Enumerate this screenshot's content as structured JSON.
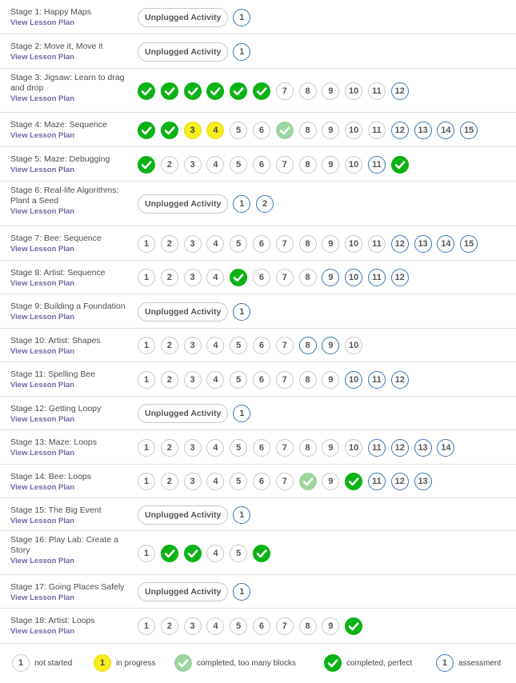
{
  "link_label": "View Lesson Plan",
  "stages": [
    {
      "title": "Stage 1: Happy Maps",
      "unplugged": "Unplugged Activity",
      "bubbles": [
        {
          "label": "1",
          "state": "assessment"
        }
      ]
    },
    {
      "title": "Stage 2: Move it, Move it",
      "unplugged": "Unplugged Activity",
      "bubbles": [
        {
          "label": "1",
          "state": "assessment"
        }
      ]
    },
    {
      "title": "Stage 3: Jigsaw: Learn to drag and drop",
      "bubbles": [
        {
          "label": "1",
          "state": "perfect"
        },
        {
          "label": "2",
          "state": "perfect"
        },
        {
          "label": "3",
          "state": "perfect"
        },
        {
          "label": "4",
          "state": "perfect"
        },
        {
          "label": "5",
          "state": "perfect"
        },
        {
          "label": "6",
          "state": "perfect"
        },
        {
          "label": "7",
          "state": "not-started"
        },
        {
          "label": "8",
          "state": "not-started"
        },
        {
          "label": "9",
          "state": "not-started"
        },
        {
          "label": "10",
          "state": "not-started"
        },
        {
          "label": "11",
          "state": "not-started"
        },
        {
          "label": "12",
          "state": "assessment"
        }
      ]
    },
    {
      "title": "Stage 4: Maze: Sequence",
      "bubbles": [
        {
          "label": "1",
          "state": "perfect"
        },
        {
          "label": "2",
          "state": "perfect"
        },
        {
          "label": "3",
          "state": "in-progress"
        },
        {
          "label": "4",
          "state": "in-progress"
        },
        {
          "label": "5",
          "state": "not-started"
        },
        {
          "label": "6",
          "state": "not-started"
        },
        {
          "label": "7",
          "state": "too-many-blocks"
        },
        {
          "label": "8",
          "state": "not-started"
        },
        {
          "label": "9",
          "state": "not-started"
        },
        {
          "label": "10",
          "state": "not-started"
        },
        {
          "label": "11",
          "state": "not-started"
        },
        {
          "label": "12",
          "state": "assessment"
        },
        {
          "label": "13",
          "state": "assessment"
        },
        {
          "label": "14",
          "state": "assessment"
        },
        {
          "label": "15",
          "state": "assessment"
        }
      ]
    },
    {
      "title": "Stage 5: Maze: Debugging",
      "bubbles": [
        {
          "label": "1",
          "state": "perfect"
        },
        {
          "label": "2",
          "state": "not-started"
        },
        {
          "label": "3",
          "state": "not-started"
        },
        {
          "label": "4",
          "state": "not-started"
        },
        {
          "label": "5",
          "state": "not-started"
        },
        {
          "label": "6",
          "state": "not-started"
        },
        {
          "label": "7",
          "state": "not-started"
        },
        {
          "label": "8",
          "state": "not-started"
        },
        {
          "label": "9",
          "state": "not-started"
        },
        {
          "label": "10",
          "state": "not-started"
        },
        {
          "label": "11",
          "state": "assessment"
        },
        {
          "label": "12",
          "state": "perfect"
        }
      ]
    },
    {
      "title": "Stage 6: Real-life Algorithms: Plant a Seed",
      "unplugged": "Unplugged Activity",
      "bubbles": [
        {
          "label": "1",
          "state": "assessment"
        },
        {
          "label": "2",
          "state": "assessment"
        }
      ]
    },
    {
      "title": "Stage 7: Bee: Sequence",
      "bubbles": [
        {
          "label": "1",
          "state": "not-started"
        },
        {
          "label": "2",
          "state": "not-started"
        },
        {
          "label": "3",
          "state": "not-started"
        },
        {
          "label": "4",
          "state": "not-started"
        },
        {
          "label": "5",
          "state": "not-started"
        },
        {
          "label": "6",
          "state": "not-started"
        },
        {
          "label": "7",
          "state": "not-started"
        },
        {
          "label": "8",
          "state": "not-started"
        },
        {
          "label": "9",
          "state": "not-started"
        },
        {
          "label": "10",
          "state": "not-started"
        },
        {
          "label": "11",
          "state": "not-started"
        },
        {
          "label": "12",
          "state": "assessment"
        },
        {
          "label": "13",
          "state": "assessment"
        },
        {
          "label": "14",
          "state": "assessment"
        },
        {
          "label": "15",
          "state": "assessment"
        }
      ]
    },
    {
      "title": "Stage 8: Artist: Sequence",
      "bubbles": [
        {
          "label": "1",
          "state": "not-started"
        },
        {
          "label": "2",
          "state": "not-started"
        },
        {
          "label": "3",
          "state": "not-started"
        },
        {
          "label": "4",
          "state": "not-started"
        },
        {
          "label": "5",
          "state": "perfect"
        },
        {
          "label": "6",
          "state": "not-started"
        },
        {
          "label": "7",
          "state": "not-started"
        },
        {
          "label": "8",
          "state": "not-started"
        },
        {
          "label": "9",
          "state": "assessment"
        },
        {
          "label": "10",
          "state": "assessment"
        },
        {
          "label": "11",
          "state": "assessment"
        },
        {
          "label": "12",
          "state": "assessment"
        }
      ]
    },
    {
      "title": "Stage 9: Building a Foundation",
      "unplugged": "Unplugged Activity",
      "bubbles": [
        {
          "label": "1",
          "state": "assessment"
        }
      ]
    },
    {
      "title": "Stage 10: Artist: Shapes",
      "bubbles": [
        {
          "label": "1",
          "state": "not-started"
        },
        {
          "label": "2",
          "state": "not-started"
        },
        {
          "label": "3",
          "state": "not-started"
        },
        {
          "label": "4",
          "state": "not-started"
        },
        {
          "label": "5",
          "state": "not-started"
        },
        {
          "label": "6",
          "state": "not-started"
        },
        {
          "label": "7",
          "state": "not-started"
        },
        {
          "label": "8",
          "state": "assessment"
        },
        {
          "label": "9",
          "state": "assessment"
        },
        {
          "label": "10",
          "state": "not-started"
        }
      ]
    },
    {
      "title": "Stage 11: Spelling Bee",
      "bubbles": [
        {
          "label": "1",
          "state": "not-started"
        },
        {
          "label": "2",
          "state": "not-started"
        },
        {
          "label": "3",
          "state": "not-started"
        },
        {
          "label": "4",
          "state": "not-started"
        },
        {
          "label": "5",
          "state": "not-started"
        },
        {
          "label": "6",
          "state": "not-started"
        },
        {
          "label": "7",
          "state": "not-started"
        },
        {
          "label": "8",
          "state": "not-started"
        },
        {
          "label": "9",
          "state": "not-started"
        },
        {
          "label": "10",
          "state": "assessment"
        },
        {
          "label": "11",
          "state": "assessment"
        },
        {
          "label": "12",
          "state": "assessment"
        }
      ]
    },
    {
      "title": "Stage 12: Getting Loopy",
      "unplugged": "Unplugged Activity",
      "bubbles": [
        {
          "label": "1",
          "state": "assessment"
        }
      ]
    },
    {
      "title": "Stage 13: Maze: Loops",
      "bubbles": [
        {
          "label": "1",
          "state": "not-started"
        },
        {
          "label": "2",
          "state": "not-started"
        },
        {
          "label": "3",
          "state": "not-started"
        },
        {
          "label": "4",
          "state": "not-started"
        },
        {
          "label": "5",
          "state": "not-started"
        },
        {
          "label": "6",
          "state": "not-started"
        },
        {
          "label": "7",
          "state": "not-started"
        },
        {
          "label": "8",
          "state": "not-started"
        },
        {
          "label": "9",
          "state": "not-started"
        },
        {
          "label": "10",
          "state": "not-started"
        },
        {
          "label": "11",
          "state": "assessment"
        },
        {
          "label": "12",
          "state": "assessment"
        },
        {
          "label": "13",
          "state": "assessment"
        },
        {
          "label": "14",
          "state": "assessment"
        }
      ]
    },
    {
      "title": "Stage 14: Bee: Loops",
      "bubbles": [
        {
          "label": "1",
          "state": "not-started"
        },
        {
          "label": "2",
          "state": "not-started"
        },
        {
          "label": "3",
          "state": "not-started"
        },
        {
          "label": "4",
          "state": "not-started"
        },
        {
          "label": "5",
          "state": "not-started"
        },
        {
          "label": "6",
          "state": "not-started"
        },
        {
          "label": "7",
          "state": "not-started"
        },
        {
          "label": "8",
          "state": "too-many-blocks"
        },
        {
          "label": "9",
          "state": "not-started"
        },
        {
          "label": "10",
          "state": "perfect"
        },
        {
          "label": "11",
          "state": "assessment"
        },
        {
          "label": "12",
          "state": "assessment"
        },
        {
          "label": "13",
          "state": "assessment"
        }
      ]
    },
    {
      "title": "Stage 15: The Big Event",
      "unplugged": "Unplugged Activity",
      "bubbles": [
        {
          "label": "1",
          "state": "assessment"
        }
      ]
    },
    {
      "title": "Stage 16: Play Lab: Create a Story",
      "bubbles": [
        {
          "label": "1",
          "state": "not-started"
        },
        {
          "label": "2",
          "state": "perfect"
        },
        {
          "label": "3",
          "state": "perfect"
        },
        {
          "label": "4",
          "state": "not-started"
        },
        {
          "label": "5",
          "state": "not-started"
        },
        {
          "label": "6",
          "state": "perfect"
        }
      ]
    },
    {
      "title": "Stage 17: Going Places Safely",
      "unplugged": "Unplugged Activity",
      "bubbles": [
        {
          "label": "1",
          "state": "assessment"
        }
      ]
    },
    {
      "title": "Stage 18: Artist: Loops",
      "bubbles": [
        {
          "label": "1",
          "state": "not-started"
        },
        {
          "label": "2",
          "state": "not-started"
        },
        {
          "label": "3",
          "state": "not-started"
        },
        {
          "label": "4",
          "state": "not-started"
        },
        {
          "label": "5",
          "state": "not-started"
        },
        {
          "label": "6",
          "state": "not-started"
        },
        {
          "label": "7",
          "state": "not-started"
        },
        {
          "label": "8",
          "state": "not-started"
        },
        {
          "label": "9",
          "state": "not-started"
        },
        {
          "label": "10",
          "state": "perfect"
        }
      ]
    }
  ],
  "legend": [
    {
      "label": "1",
      "state": "not-started",
      "text": "not started"
    },
    {
      "label": "1",
      "state": "in-progress",
      "text": "in progress"
    },
    {
      "label": "",
      "state": "too-many-blocks",
      "text": "completed, too many blocks"
    },
    {
      "label": "",
      "state": "perfect",
      "text": "completed, perfect"
    },
    {
      "label": "1",
      "state": "assessment",
      "text": "assessment"
    }
  ],
  "colors": {
    "perfect": "#0ab314",
    "too_many_blocks": "#9ed4a0",
    "in_progress": "#f6ee1d",
    "assessment_border": "#3a74b5",
    "link": "#7665a0"
  }
}
